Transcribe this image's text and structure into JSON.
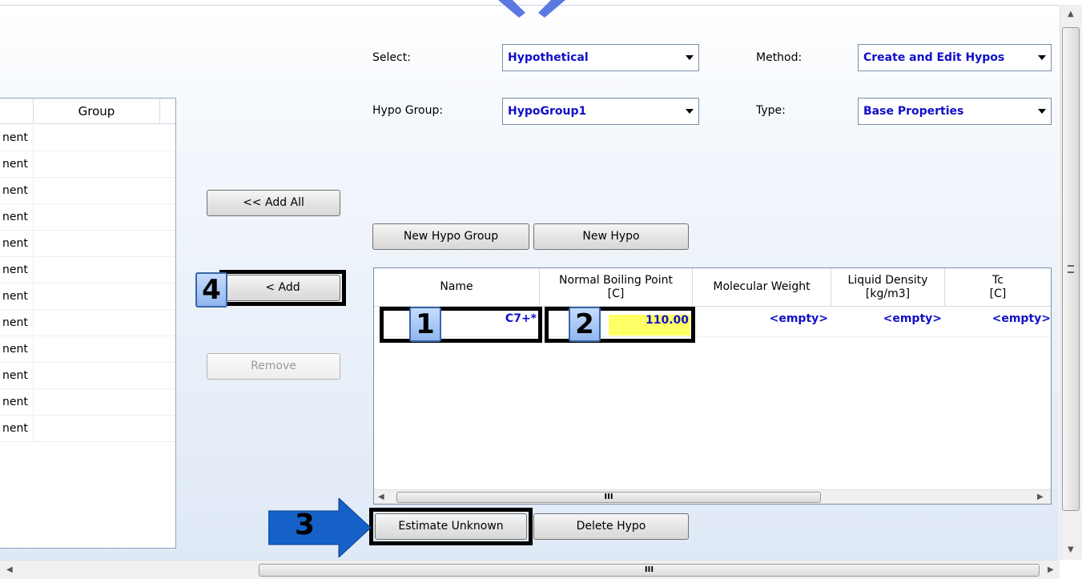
{
  "top_form": {
    "select_label": "Select:",
    "select_value": "Hypothetical",
    "method_label": "Method:",
    "method_value": "Create and Edit Hypos",
    "hypo_group_label": "Hypo Group:",
    "hypo_group_value": "HypoGroup1",
    "type_label": "Type:",
    "type_value": "Base Properties"
  },
  "left_list": {
    "header_group": "Group",
    "rows": [
      "nent",
      "nent",
      "nent",
      "nent",
      "nent",
      "nent",
      "nent",
      "nent",
      "nent",
      "nent",
      "nent",
      "nent"
    ]
  },
  "middle_buttons": {
    "add_all": "<< Add All",
    "add": "< Add",
    "remove": "Remove"
  },
  "hypo_buttons": {
    "new_hypo_group": "New Hypo Group",
    "new_hypo": "New Hypo",
    "estimate_unknown": "Estimate Unknown",
    "delete_hypo": "Delete Hypo"
  },
  "grid": {
    "headers": {
      "name": "Name",
      "nbp": "Normal Boiling Point\n[C]",
      "mw": "Molecular Weight",
      "ld": "Liquid Density\n[kg/m3]",
      "tc": "Tc\n[C]"
    },
    "row": {
      "name": "C7+*",
      "nbp": "110.00",
      "mw": "<empty>",
      "ld": "<empty>",
      "tc": "<empty>"
    },
    "scroll_thumb": "III"
  },
  "callouts": {
    "c1": "1",
    "c2": "2",
    "c3": "3",
    "c4": "4"
  },
  "bottom_scroll_thumb": "III",
  "colors": {
    "accent_text": "#1010c8",
    "highlight_cell": "#ffff66",
    "callout_blue": "#8fb6ee",
    "arrow_blue": "#1561c8"
  }
}
